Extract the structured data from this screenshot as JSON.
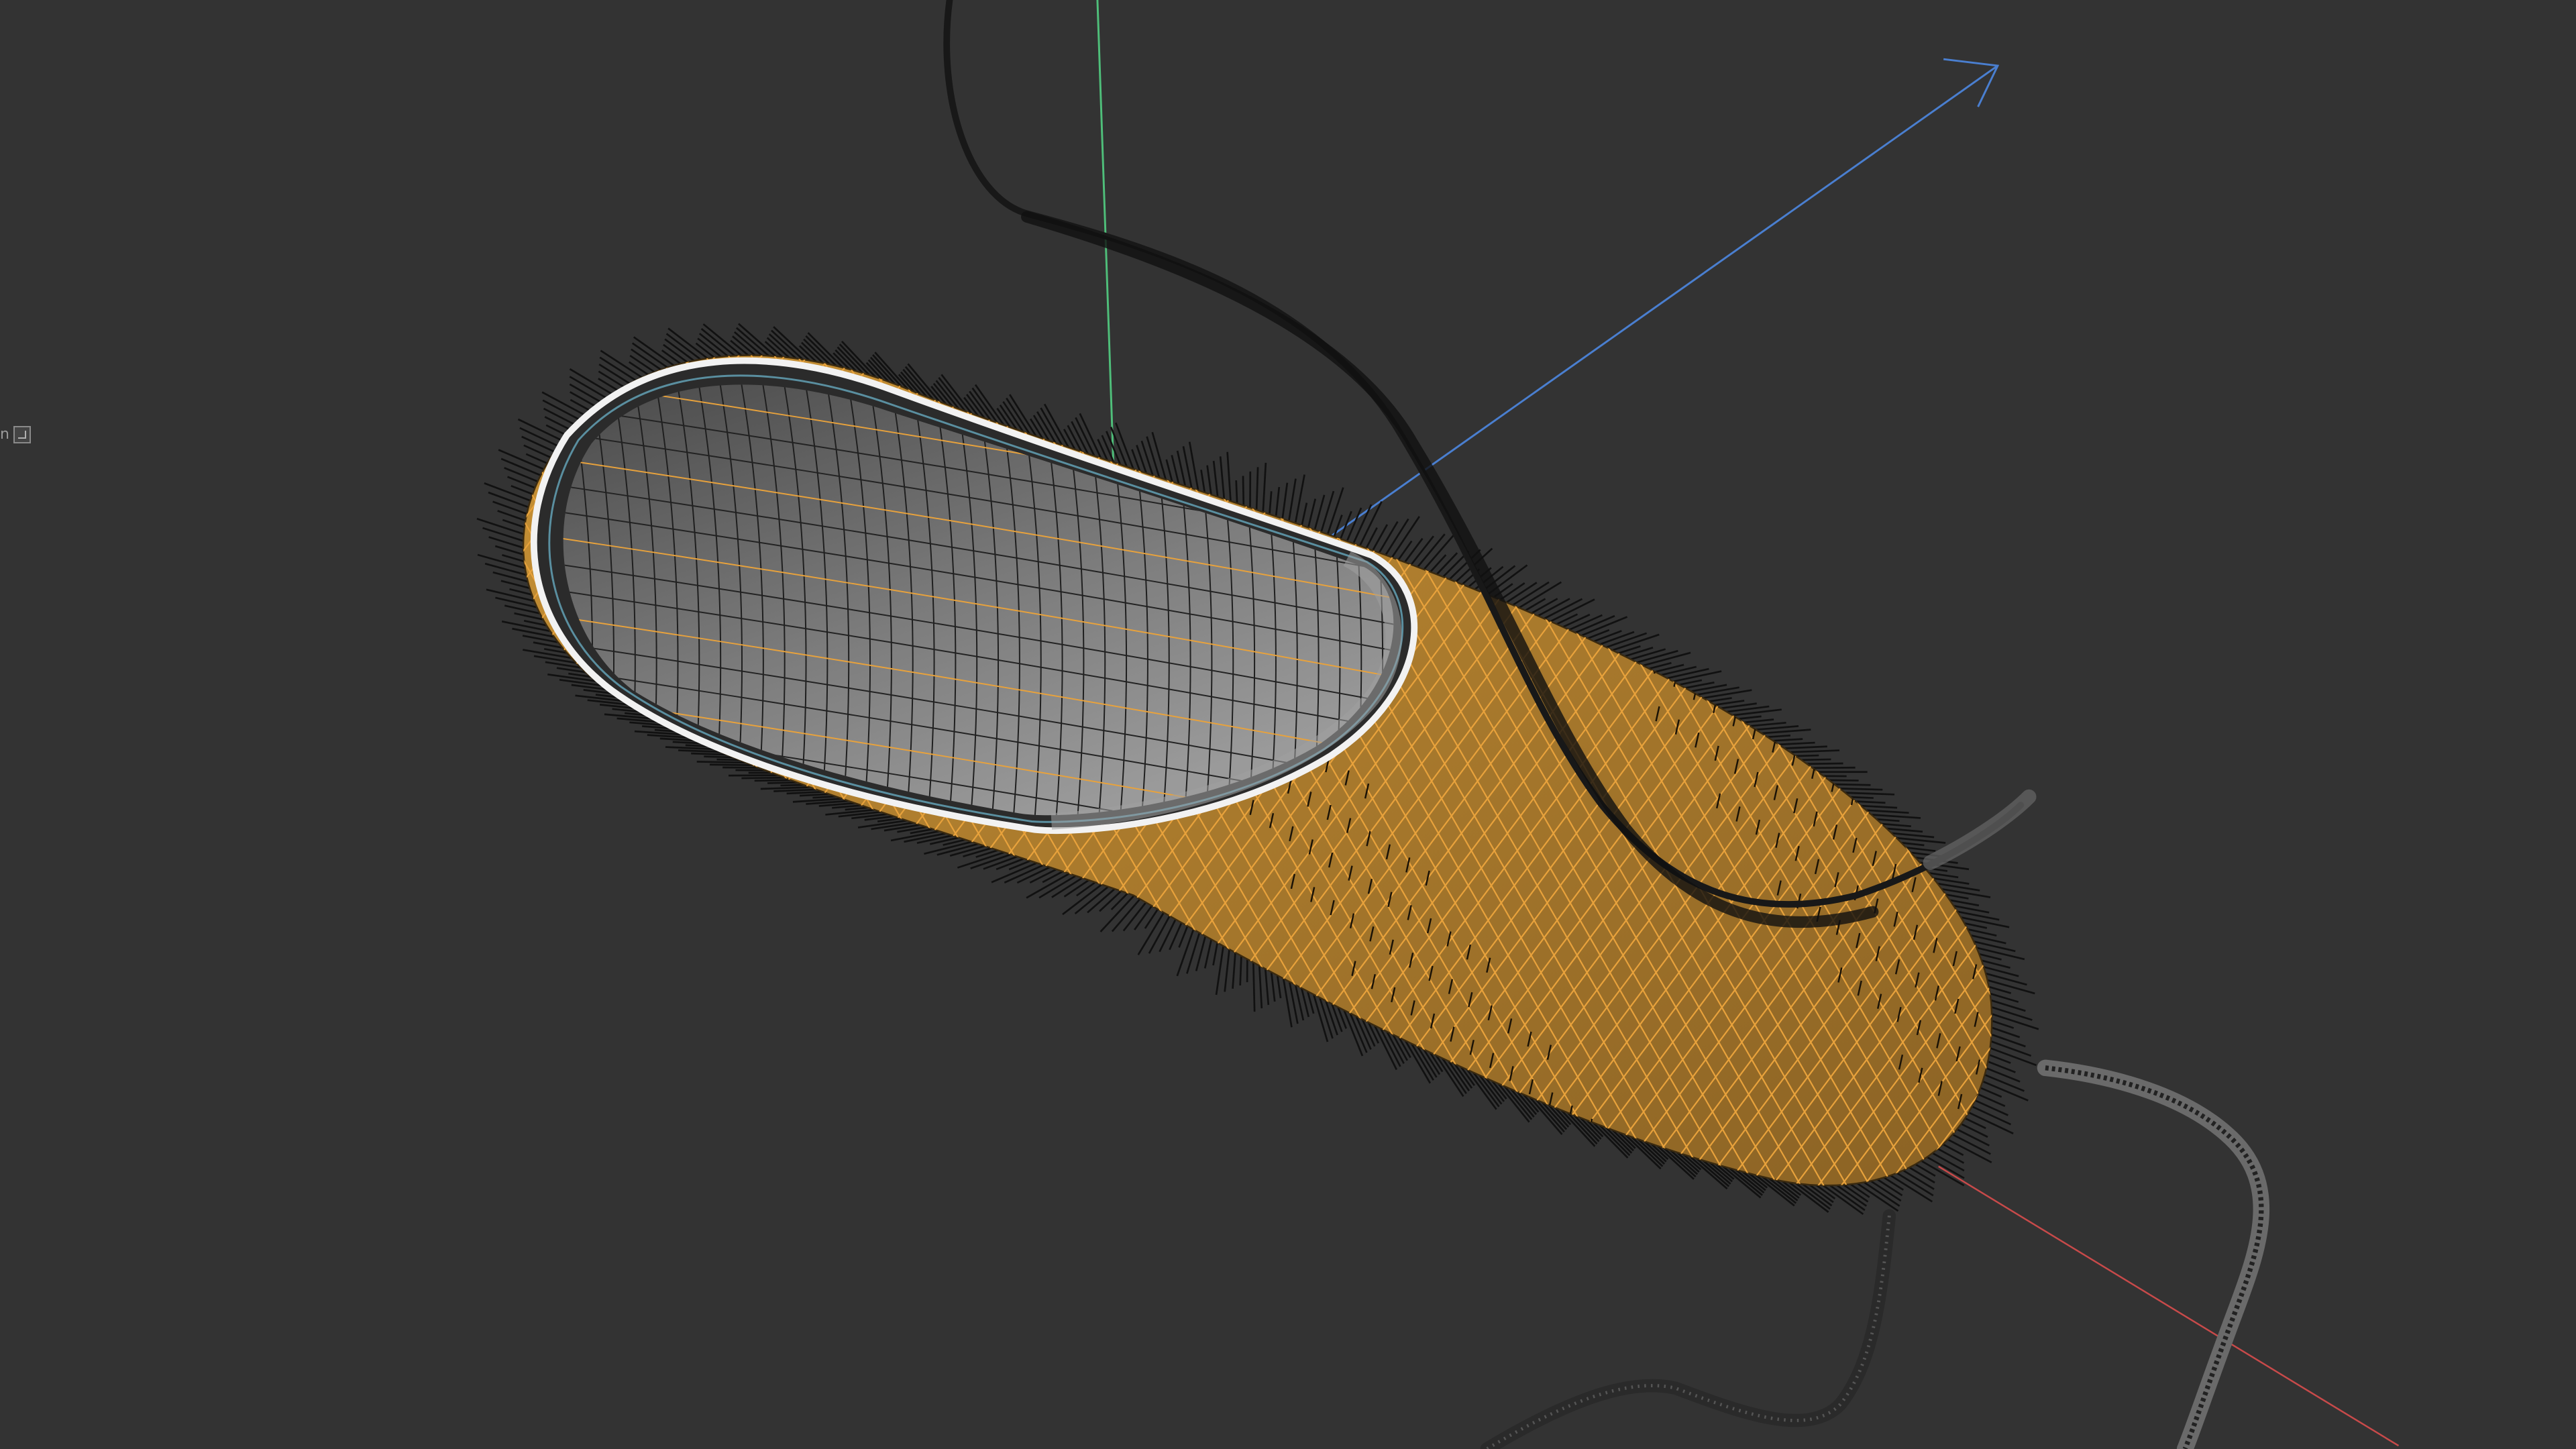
{
  "viewport": {
    "background_color": "#333333",
    "side_handle": {
      "text": "n",
      "icon": "panel-toggle-icon"
    }
  },
  "scene": {
    "object": "bacterium-cutaway-model",
    "colors": {
      "wireframe": "#e8a23c",
      "surface_fill": "#b8862f",
      "interior_fill": "#6e6e6e",
      "cilia": "#111111",
      "flagella": "#1c1c1c",
      "membrane_rim": "#e9e9e9",
      "axis_x": "#c84a4a",
      "axis_y": "#4fbf7a",
      "axis_z": "#4a7fd0"
    },
    "axes": [
      "x",
      "y",
      "z"
    ]
  }
}
